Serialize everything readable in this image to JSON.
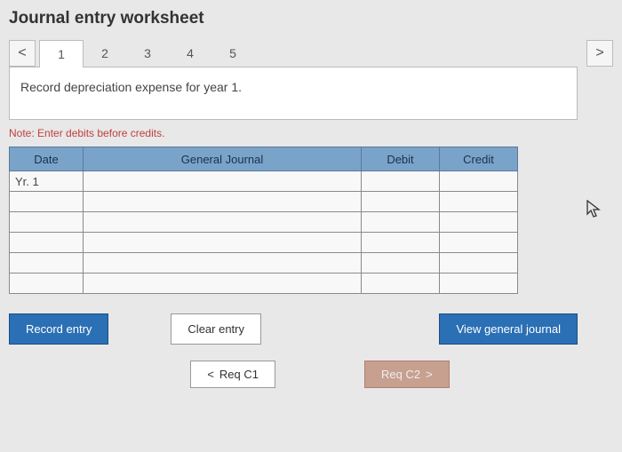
{
  "title": "Journal entry worksheet",
  "nav": {
    "prev": "<",
    "next": ">"
  },
  "tabs": [
    "1",
    "2",
    "3",
    "4",
    "5"
  ],
  "active_tab": 0,
  "instruction": "Record depreciation expense for year 1.",
  "note": "Note: Enter debits before credits.",
  "table": {
    "headers": {
      "date": "Date",
      "gj": "General Journal",
      "debit": "Debit",
      "credit": "Credit"
    },
    "rows": [
      {
        "date": "Yr. 1",
        "gj": "",
        "debit": "",
        "credit": ""
      },
      {
        "date": "",
        "gj": "",
        "debit": "",
        "credit": ""
      },
      {
        "date": "",
        "gj": "",
        "debit": "",
        "credit": ""
      },
      {
        "date": "",
        "gj": "",
        "debit": "",
        "credit": ""
      },
      {
        "date": "",
        "gj": "",
        "debit": "",
        "credit": ""
      },
      {
        "date": "",
        "gj": "",
        "debit": "",
        "credit": ""
      }
    ]
  },
  "buttons": {
    "record": "Record entry",
    "clear": "Clear entry",
    "view": "View general journal"
  },
  "footer": {
    "req_prev": "Req C1",
    "req_next": "Req C2"
  },
  "chart_data": {
    "type": "table",
    "title": "Journal entry worksheet",
    "headers": [
      "Date",
      "General Journal",
      "Debit",
      "Credit"
    ],
    "rows": [
      [
        "Yr. 1",
        "",
        "",
        ""
      ],
      [
        "",
        "",
        "",
        ""
      ],
      [
        "",
        "",
        "",
        ""
      ],
      [
        "",
        "",
        "",
        ""
      ],
      [
        "",
        "",
        "",
        ""
      ],
      [
        "",
        "",
        "",
        ""
      ]
    ]
  }
}
